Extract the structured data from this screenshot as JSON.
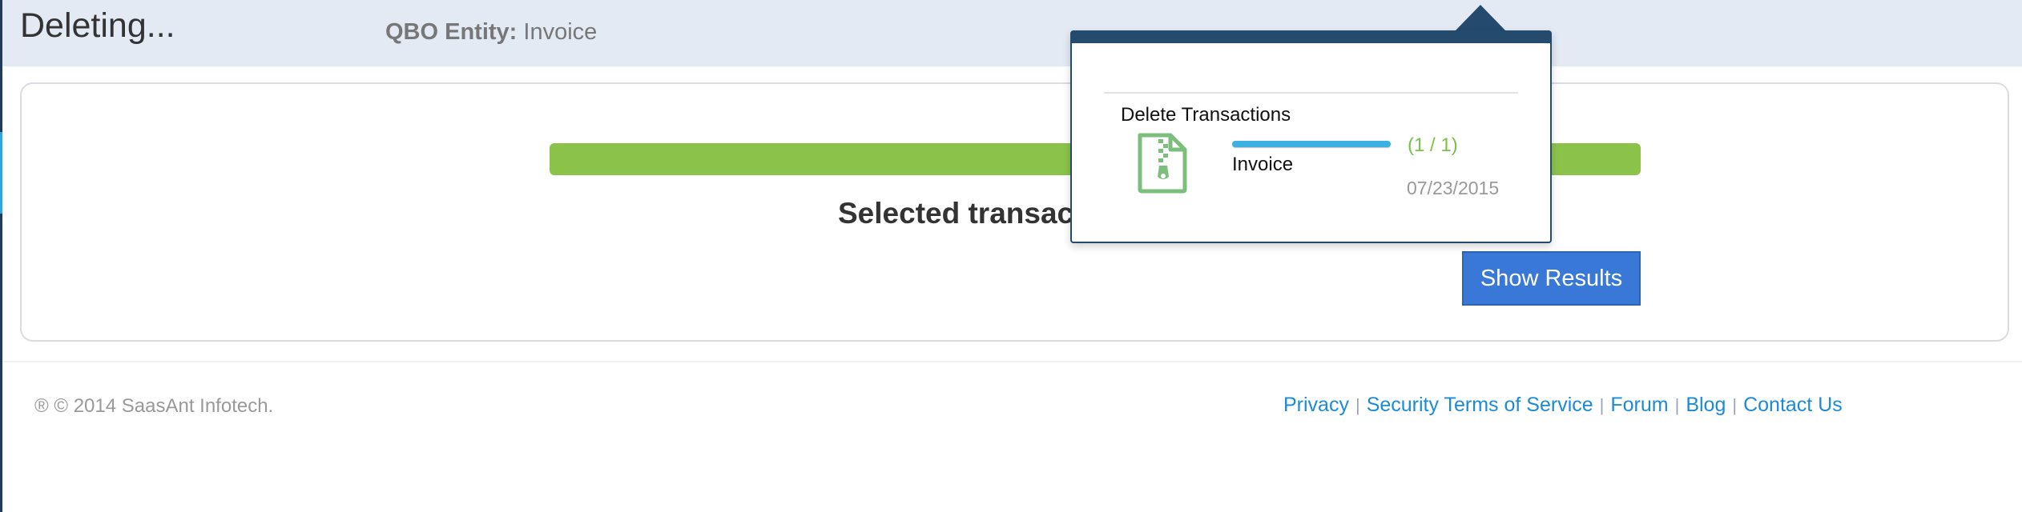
{
  "header": {
    "title": "Deleting...",
    "entity_label": "QBO Entity:",
    "entity_value": "Invoice"
  },
  "main": {
    "status_text": "Selected transact",
    "progress_percent": 100,
    "show_results_label": "Show Results"
  },
  "popover": {
    "heading": "Delete Transactions",
    "job": {
      "icon": "zip-file-icon",
      "entity": "Invoice",
      "count": "(1 / 1)",
      "date": "07/23/2015",
      "progress_percent": 100
    }
  },
  "footer": {
    "copyright": "® © 2014 SaasAnt Infotech.",
    "links": [
      "Privacy",
      "Security Terms of Service",
      "Forum",
      "Blog",
      "Contact Us"
    ],
    "separator": "|"
  },
  "colors": {
    "header_bg": "#e3eaf4",
    "progress_green": "#8bc34a",
    "button_blue": "#3a78d8",
    "popover_navy": "#244a6e",
    "link_blue": "#1c8bd6",
    "icon_green": "#7cbf7c"
  }
}
